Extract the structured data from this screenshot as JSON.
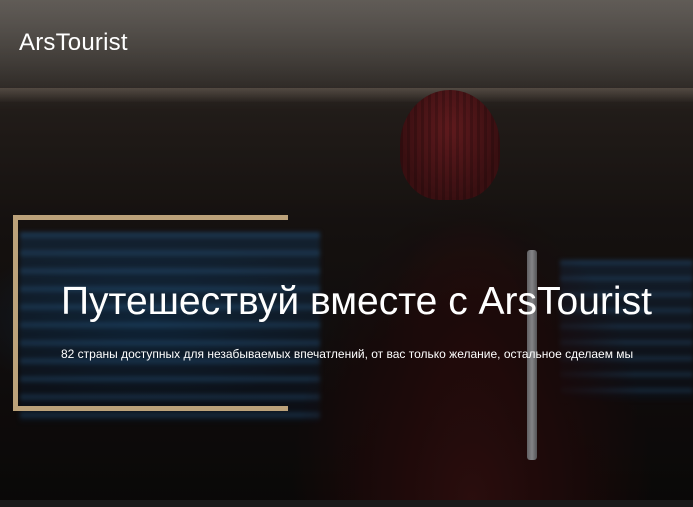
{
  "header": {
    "brand": "ArsTourist"
  },
  "hero": {
    "headline": "Путешествуй вместе с ArsTourist",
    "subline": "82 страны доступных для незабываемых впечатлений, от вас только желание, остальное сделаем мы",
    "frame_color": "#bca27a",
    "background_image": "traveler-in-red-beanie-at-airport-departure-board"
  }
}
